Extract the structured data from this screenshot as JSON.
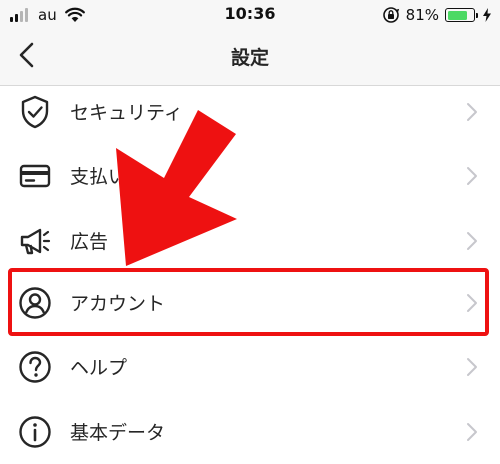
{
  "status_bar": {
    "carrier": "au",
    "time": "10:36",
    "battery_percent": "81%",
    "battery_level": 0.81,
    "battery_color": "#4cd964"
  },
  "nav": {
    "title": "設定",
    "back_icon": "chevron-left-icon"
  },
  "settings": {
    "items": [
      {
        "label": "セキュリティ",
        "icon": "shield-check-icon"
      },
      {
        "label": "支払い",
        "icon": "credit-card-icon"
      },
      {
        "label": "広告",
        "icon": "megaphone-icon"
      },
      {
        "label": "アカウント",
        "icon": "account-circle-icon",
        "highlighted": true
      },
      {
        "label": "ヘルプ",
        "icon": "help-circle-icon"
      },
      {
        "label": "基本データ",
        "icon": "info-circle-icon"
      }
    ]
  },
  "annotation": {
    "highlight_color": "#ee1111",
    "arrow_color": "#ee1111",
    "arrow_target": "アカウント"
  }
}
